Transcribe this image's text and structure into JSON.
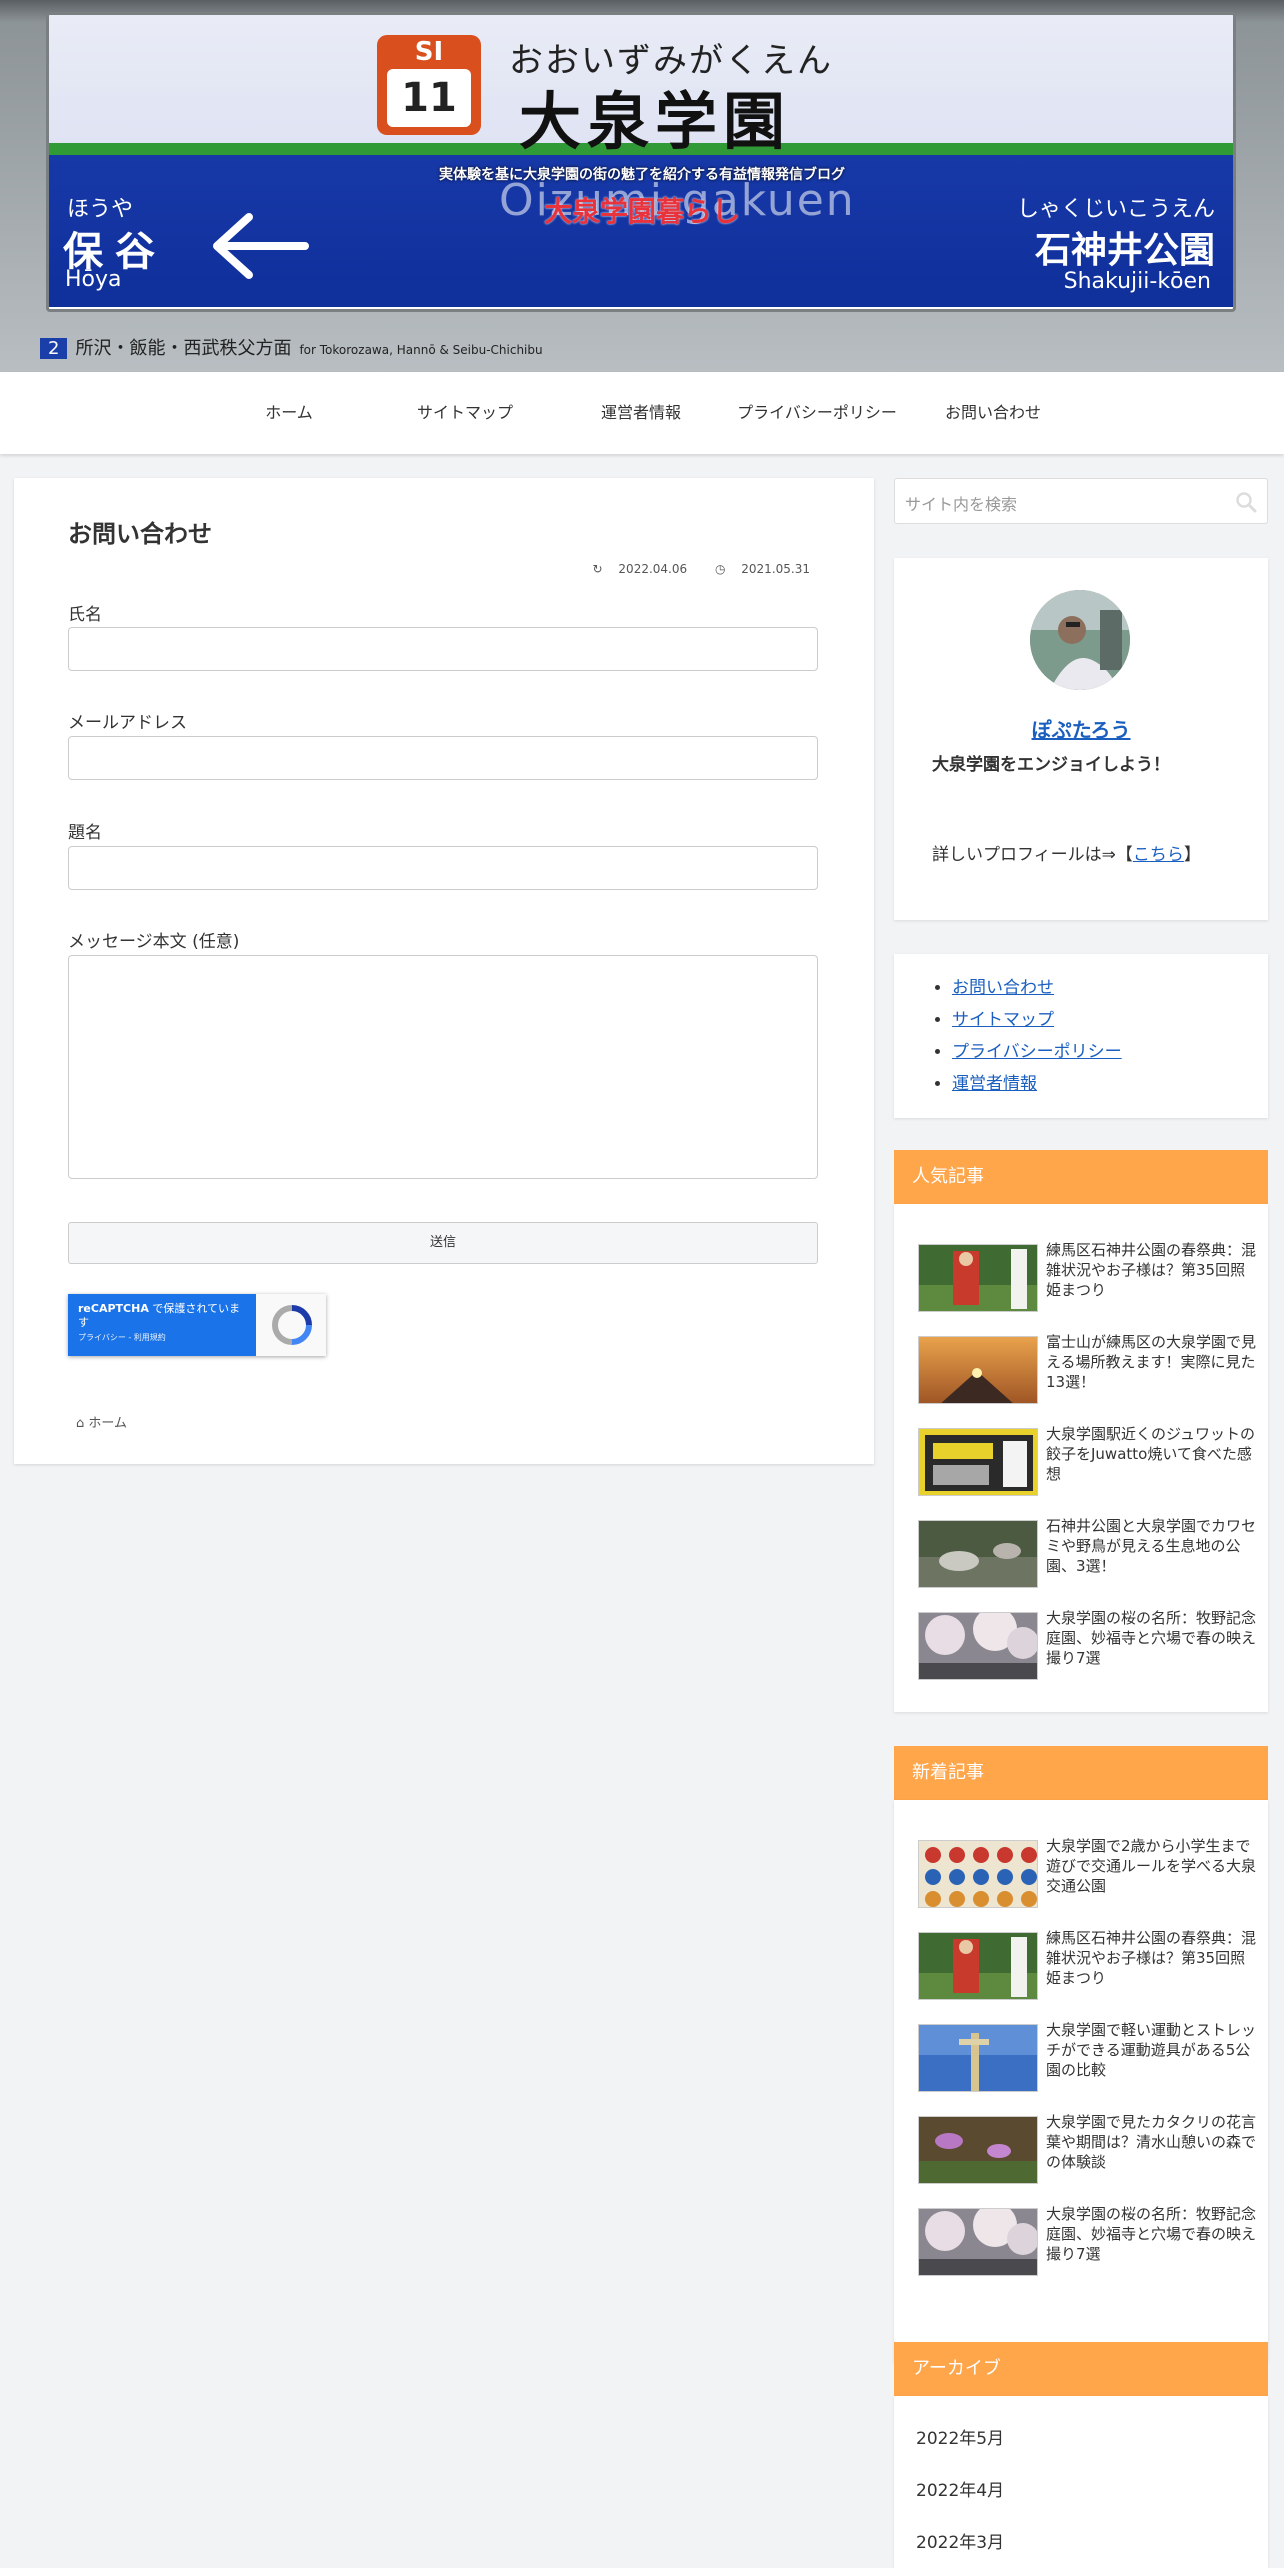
{
  "header": {
    "tagline": "実体験を基に大泉学園の街の魅了を紹介する有益情報発信ブログ",
    "title": "大泉学園暮らし",
    "sign": {
      "line_code": "SI",
      "station_no": "11",
      "kana": "おおいずみがくえん",
      "kanji": "大泉学園",
      "roman": "Oizumi-gakuen",
      "left_kana": "ほうや",
      "left_kanji": "保谷",
      "left_roman": "Hōya",
      "right_kana": "しゃくじいこうえん",
      "right_kanji": "石神井公園",
      "right_roman": "Shakujii-kōen",
      "platform_no": "2",
      "direction": "所沢・飯能・西武秩父方面",
      "direction_en": "for Tokorozawa, Hannō & Seibu-Chichibu"
    }
  },
  "nav": {
    "items": [
      {
        "label": "ホーム"
      },
      {
        "label": "サイトマップ"
      },
      {
        "label": "運営者情報"
      },
      {
        "label": "プライバシーポリシー"
      },
      {
        "label": "お問い合わせ"
      }
    ]
  },
  "main": {
    "title": "お問い合わせ",
    "updated": "2022.04.06",
    "published": "2021.05.31",
    "form": {
      "name_label": "氏名",
      "email_label": "メールアドレス",
      "subject_label": "題名",
      "message_label": "メッセージ本文 (任意)",
      "submit_label": "送信"
    },
    "recaptcha": {
      "brand": "reCAPTCHA",
      "text": "で保護されています",
      "links": "プライバシー - 利用規約"
    },
    "breadcrumb": "ホーム"
  },
  "sidebar": {
    "search_placeholder": "サイト内を検索",
    "profile": {
      "name": "ぽぷたろう",
      "tagline": "大泉学園をエンジョイしよう！",
      "more_prefix": "詳しいプロフィールは⇒【",
      "more_link": "こちら",
      "more_suffix": "】"
    },
    "links": [
      {
        "label": "お問い合わせ"
      },
      {
        "label": "サイトマップ"
      },
      {
        "label": "プライバシーポリシー"
      },
      {
        "label": "運営者情報"
      }
    ],
    "popular": {
      "title": "人気記事",
      "posts": [
        {
          "title": "練馬区石神井公園の春祭典：混雑状況やお子様は？第35回照姫まつり"
        },
        {
          "title": "富士山が練馬区の大泉学園で見える場所教えます！実際に見た13選！"
        },
        {
          "title": "大泉学園駅近くのジュワットの餃子をJuwatto焼いて食べた感想"
        },
        {
          "title": "石神井公園と大泉学園でカワセミや野鳥が見える生息地の公園、3選！"
        },
        {
          "title": "大泉学園の桜の名所：牧野記念庭園、妙福寺と穴場で春の映え撮り7選"
        }
      ]
    },
    "recent": {
      "title": "新着記事",
      "posts": [
        {
          "title": "大泉学園で2歳から小学生まで遊びで交通ルールを学べる大泉交通公園"
        },
        {
          "title": "練馬区石神井公園の春祭典：混雑状況やお子様は？第35回照姫まつり"
        },
        {
          "title": "大泉学園で軽い運動とストレッチができる運動遊具がある5公園の比較"
        },
        {
          "title": "大泉学園で見たカタクリの花言葉や期間は？清水山憩いの森での体験談"
        },
        {
          "title": "大泉学園の桜の名所：牧野記念庭園、妙福寺と穴場で春の映え撮り7選"
        }
      ]
    },
    "archive": {
      "title": "アーカイブ",
      "items": [
        {
          "label": "2022年5月"
        },
        {
          "label": "2022年4月"
        },
        {
          "label": "2022年3月"
        }
      ]
    }
  },
  "colors": {
    "accent": "#ffa54a",
    "link": "#1a5fbf",
    "title_red": "#e8323c"
  }
}
